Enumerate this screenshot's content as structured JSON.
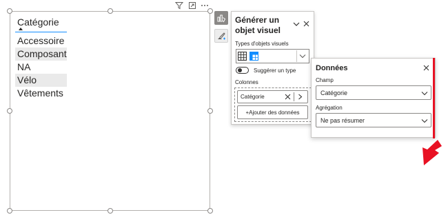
{
  "slicer": {
    "title": "Catégorie",
    "items": [
      {
        "label": "Accessoire",
        "shaded": false
      },
      {
        "label": "Composant",
        "shaded": true
      },
      {
        "label": "NA",
        "shaded": false
      },
      {
        "label": "Vélo",
        "shaded": true
      },
      {
        "label": "Vêtements",
        "shaded": false
      }
    ]
  },
  "visual_header_icons": [
    "filter-icon",
    "focus-mode-icon",
    "more-options-icon"
  ],
  "build_panel": {
    "title": "Générer un objet visuel",
    "visual_types_label": "Types d'objets visuels",
    "suggest_label": "Suggérer un type",
    "suggest_on": false,
    "columns_label": "Colonnes",
    "column_field": "Catégorie",
    "add_data_label": "+Ajouter des données"
  },
  "data_panel": {
    "title": "Données",
    "field_label": "Champ",
    "field_value": "Catégorie",
    "aggregation_label": "Agrégation",
    "aggregation_value": "Ne pas résumer"
  },
  "colors": {
    "accent_blue": "#118dff",
    "highlight_red": "#e81123"
  }
}
